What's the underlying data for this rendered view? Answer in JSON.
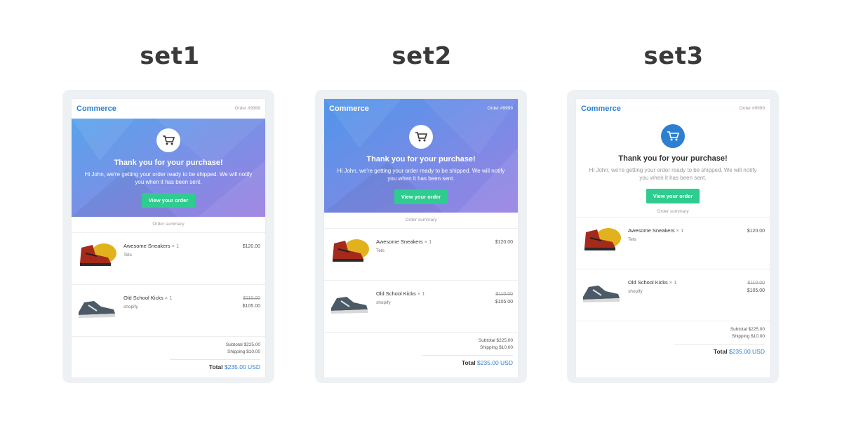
{
  "sets": [
    {
      "title": "set1",
      "brand": "Commerce",
      "order": "Order #9999",
      "variant": "gradient-hero",
      "hero": {
        "thanks": "Thank you for your purchase!",
        "message": "Hi John, we're getting your order ready to be shipped. We will notify you when it has been sent.",
        "button": "View your order",
        "cart_icon": "cart-icon"
      },
      "summary_label": "Order summary",
      "items": [
        {
          "name": "Awesome Sneakers",
          "qty": "× 1",
          "vendor": "Tets",
          "price": "$120.00",
          "old_price": "",
          "image": "red-sneaker"
        },
        {
          "name": "Old School Kicks",
          "qty": "× 1",
          "vendor": "shopify",
          "price": "$105.00",
          "old_price": "$110.00",
          "image": "grey-sneaker"
        }
      ],
      "subtotal": "Subtotal $225.00",
      "shipping": "Shipping $10.00",
      "total_label": "Total",
      "total_amount": "$235.00 USD"
    },
    {
      "title": "set2",
      "brand": "Commerce",
      "order": "Order #9999",
      "variant": "full-gradient-header",
      "hero": {
        "thanks": "Thank you for your purchase!",
        "message": "Hi John, we're getting your order ready to be shipped. We will notify you when it has been sent.",
        "button": "View your order",
        "cart_icon": "cart-icon"
      },
      "summary_label": "Order summary",
      "items": [
        {
          "name": "Awesome Sneakers",
          "qty": "× 1",
          "vendor": "Tets",
          "price": "$120.00",
          "old_price": "",
          "image": "red-sneaker"
        },
        {
          "name": "Old School Kicks",
          "qty": "× 1",
          "vendor": "shopify",
          "price": "$105.00",
          "old_price": "$110.00",
          "image": "grey-sneaker"
        }
      ],
      "subtotal": "Subtotal $225.00",
      "shipping": "Shipping $10.00",
      "total_label": "Total",
      "total_amount": "$235.00 USD"
    },
    {
      "title": "set3",
      "brand": "Commerce",
      "order": "Order #9999",
      "variant": "plain-white",
      "hero": {
        "thanks": "Thank you for your purchase!",
        "message": "Hi John, we're getting your order ready to be shipped. We will notify you when it has been sent.",
        "button": "View your order",
        "cart_icon": "cart-icon"
      },
      "summary_label": "Order summary",
      "items": [
        {
          "name": "Awesome Sneakers",
          "qty": "× 1",
          "vendor": "Tets",
          "price": "$120.00",
          "old_price": "",
          "image": "red-sneaker"
        },
        {
          "name": "Old School Kicks",
          "qty": "× 1",
          "vendor": "shopify",
          "price": "$105.00",
          "old_price": "$110.00",
          "image": "grey-sneaker"
        }
      ],
      "subtotal": "Subtotal $225.00",
      "shipping": "Shipping $10.00",
      "total_label": "Total",
      "total_amount": "$235.00 USD"
    }
  ],
  "colors": {
    "brand": "#2f7fd1",
    "button": "#2ecc8f",
    "gradient_start": "#5aa0ea",
    "gradient_end": "#9a7fe0",
    "frame": "#eef1f4"
  }
}
